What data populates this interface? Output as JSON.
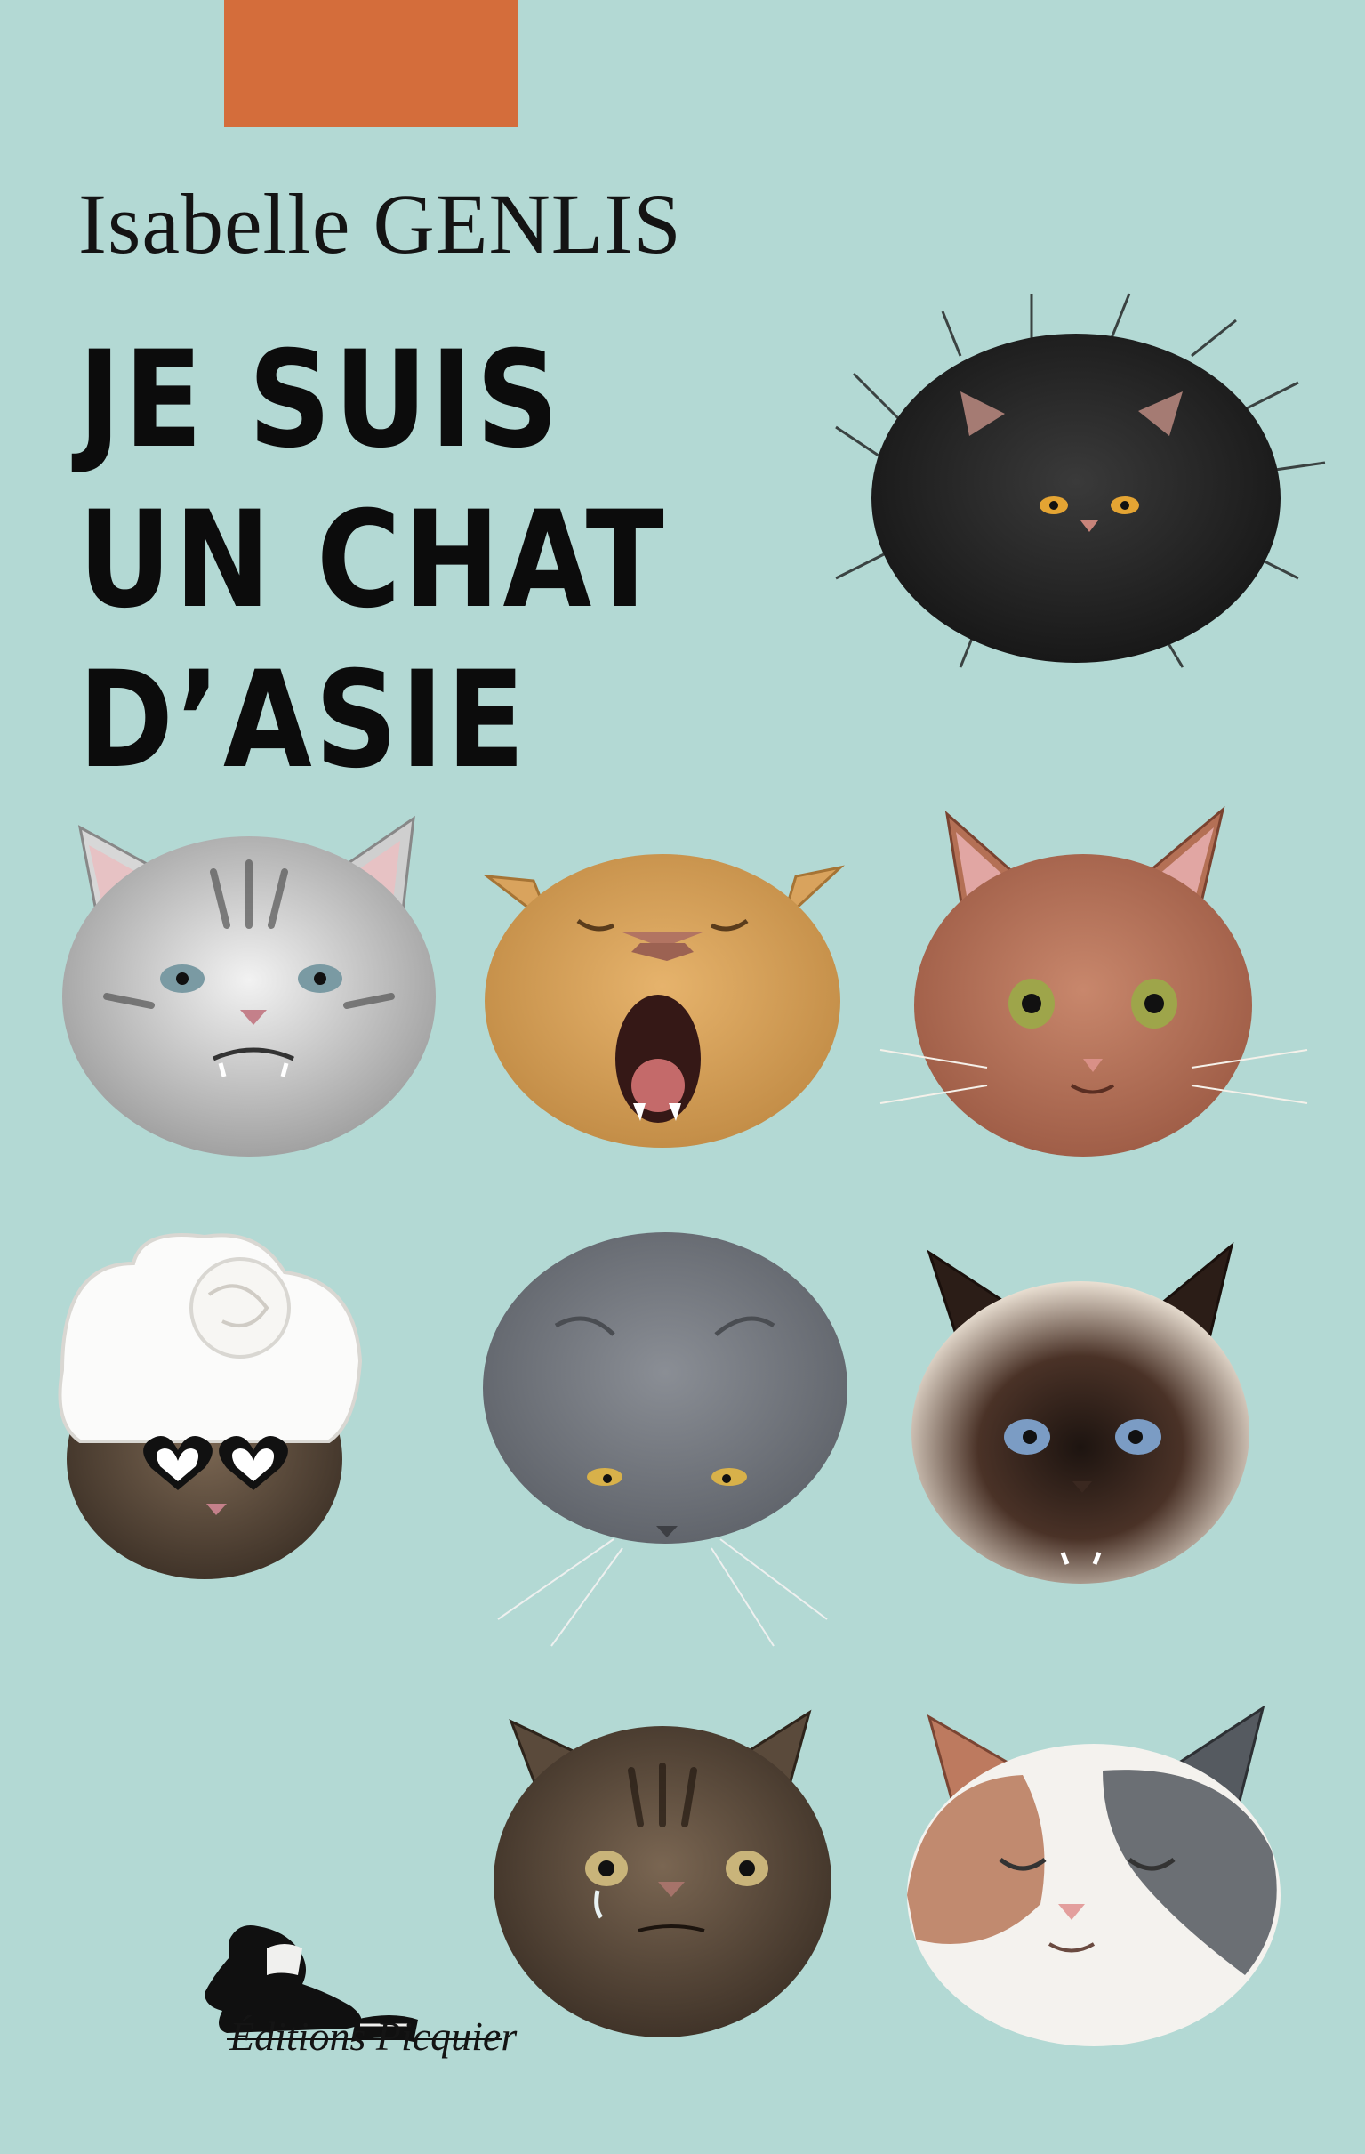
{
  "cover": {
    "author": "Isabelle GENLIS",
    "title_lines": [
      "JE SUIS",
      "UN CHAT",
      "D’ASIE"
    ],
    "publisher": "Éditions Picquier"
  },
  "colors": {
    "background": "#b3d9d4",
    "accent_tab": "#d46d3b",
    "text": "#141414"
  },
  "illustrations": [
    "black-fluffy-cat-icon",
    "grey-tabby-cat-icon",
    "yawning-orange-cat-icon",
    "red-cat-icon",
    "turban-sunglasses-cat-icon",
    "grey-cat-icon",
    "siamese-cat-icon",
    "crying-tabby-cat-icon",
    "calico-cat-icon"
  ]
}
